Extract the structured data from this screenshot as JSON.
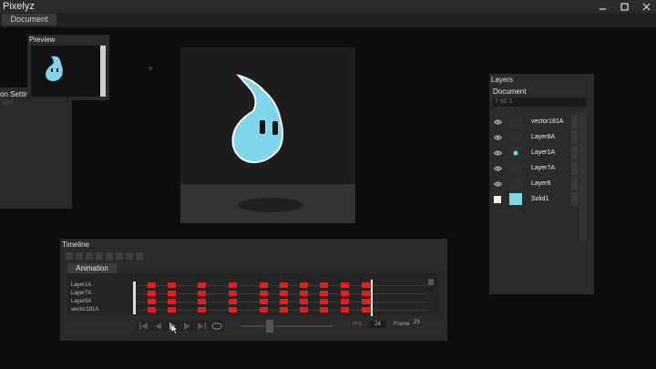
{
  "app": {
    "title": "Pixelyz",
    "document_tab": "Document"
  },
  "preview": {
    "title": "Preview"
  },
  "settings": {
    "title": "on Settings",
    "sub": "ayer"
  },
  "layers": {
    "title": "Layers",
    "document_label": "Document",
    "document_value": "7 60 1",
    "items": [
      {
        "name": "vector181A",
        "visible": true
      },
      {
        "name": "Layer8A",
        "visible": true
      },
      {
        "name": "Layer1A",
        "visible": true
      },
      {
        "name": "Layer7A",
        "visible": true
      },
      {
        "name": "Layer6",
        "visible": true
      },
      {
        "name": "Solid1",
        "visible": false,
        "color": "#7fd6ea"
      }
    ]
  },
  "timeline": {
    "title": "Timeline",
    "tab": "Animation",
    "tracks": [
      "Layer1A",
      "Layer7A",
      "Layer8A",
      "vector181A"
    ],
    "keyframes": 11,
    "fps_label": "FPS",
    "fps": "24",
    "frame_label": "Frame",
    "frame": "23",
    "speed_slider": 0.3
  },
  "colors": {
    "accent": "#7fd6ea",
    "keyframe": "#e41e1e"
  },
  "icons": [
    "close-icon",
    "maximize-icon",
    "minimize-icon",
    "eye-icon",
    "skip-start-icon",
    "step-back-icon",
    "play-icon",
    "step-forward-icon",
    "skip-end-icon",
    "loop-icon"
  ]
}
